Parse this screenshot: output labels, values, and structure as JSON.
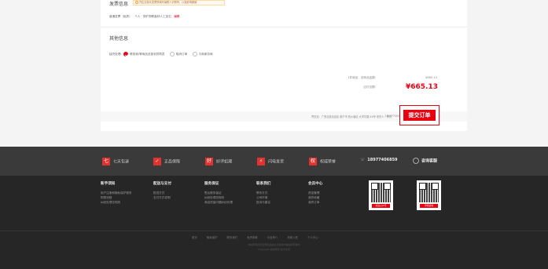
{
  "invoice": {
    "title": "发票信息",
    "tip": "开企业抬头发票须填写纳税人识别号，以免影响报销",
    "type_label": "普通发票（纸质）",
    "type_personal": "个人",
    "type_detail": "张旷物联森林人工加石",
    "edit_link": "编辑"
  },
  "other": {
    "title": "其他信息",
    "handle_label": "缺货处理:",
    "options": [
      "联络我/等商品全部到货再发",
      "取消订单",
      "与商家协商"
    ],
    "selected_index": 0
  },
  "summary": {
    "count_text": "1件商品，总商品金额:",
    "goods_amount": "¥665.13",
    "payable_label": "应付总额:",
    "payable_amount": "¥665.13",
    "ship_text": "寄送至：广西壮族自治区 南宁市 西乡塘区 大学东路 XX号 收货人：黄试",
    "phone_text": "185077404"
  },
  "submit_label": "提交订单",
  "services": [
    {
      "icon": "七",
      "label": "七天包退"
    },
    {
      "icon": "✓",
      "label": "正品保障"
    },
    {
      "icon": "好",
      "label": "好评如潮"
    },
    {
      "icon": "⚡",
      "label": "闪电发货"
    },
    {
      "icon": "权",
      "label": "权威荣誉"
    }
  ],
  "hotline": "18977406859",
  "service_online": "咨询客服",
  "footer_cols": [
    {
      "title": "新手须知",
      "items": [
        "用户注册和隐私保护服务",
        "购物流程",
        "纠纷处理总规则"
      ]
    },
    {
      "title": "配送与支付",
      "items": [
        "配送方式",
        "支付方式说明"
      ]
    },
    {
      "title": "服务保证",
      "items": [
        "售后服务保证",
        "纠纷处理总规则",
        "商品质量问题纠纷处理"
      ]
    },
    {
      "title": "联系我们",
      "items": [
        "联系方式",
        "公司环境",
        "投诉与建议"
      ]
    },
    {
      "title": "会员中心",
      "items": [
        "资金管理",
        "我的收藏",
        "我的订单"
      ]
    }
  ],
  "qr_caption_1": "关注公众号",
  "qr_caption_2": "手机商城",
  "bottom_links": [
    "首页",
    "隐私保护",
    "联系我们",
    "免责条款",
    "平台简介",
    "商家入驻",
    "个人中心"
  ],
  "copyright_1": "本站所展示的全部商品信息及其他内容由商家发布",
  "copyright_2": "Copyright 版权所有 技术支持"
}
